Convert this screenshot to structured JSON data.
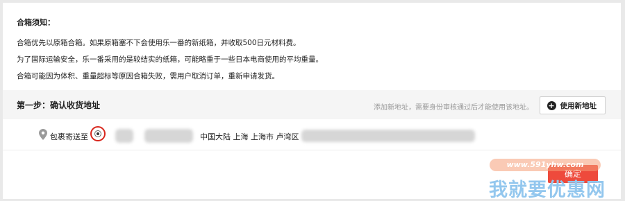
{
  "notice": {
    "title": "合箱须知：",
    "lines": [
      "合箱优先以原箱合箱。如果原箱塞不下会使用乐一番的新纸箱，并收取500日元材料费。",
      "为了国际运输安全，乐一番采用的是较结实的纸箱，可能略重于一些日本电商使用的平均重量。",
      "合箱可能因为体积、重量超标等原因合箱失败，需用户取消订单，重新申请发货。"
    ]
  },
  "step": {
    "title": "第一步：确认收货地址",
    "hint": "添加新地址，需要身份审核通过后才能使用该地址。",
    "new_address_label": "使用新地址",
    "plus_icon": "+"
  },
  "address": {
    "ship_to_label": "包裹寄送至",
    "region_text": "中国大陆 上海 上海市 卢湾区"
  },
  "confirm_label": "确定",
  "watermark": {
    "url": "www.591yhw.com",
    "text": "我就要优惠网"
  },
  "colors": {
    "accent_red": "#d8261c",
    "button_red": "#ee4a3c",
    "watermark_blue": "#93c7ee"
  }
}
